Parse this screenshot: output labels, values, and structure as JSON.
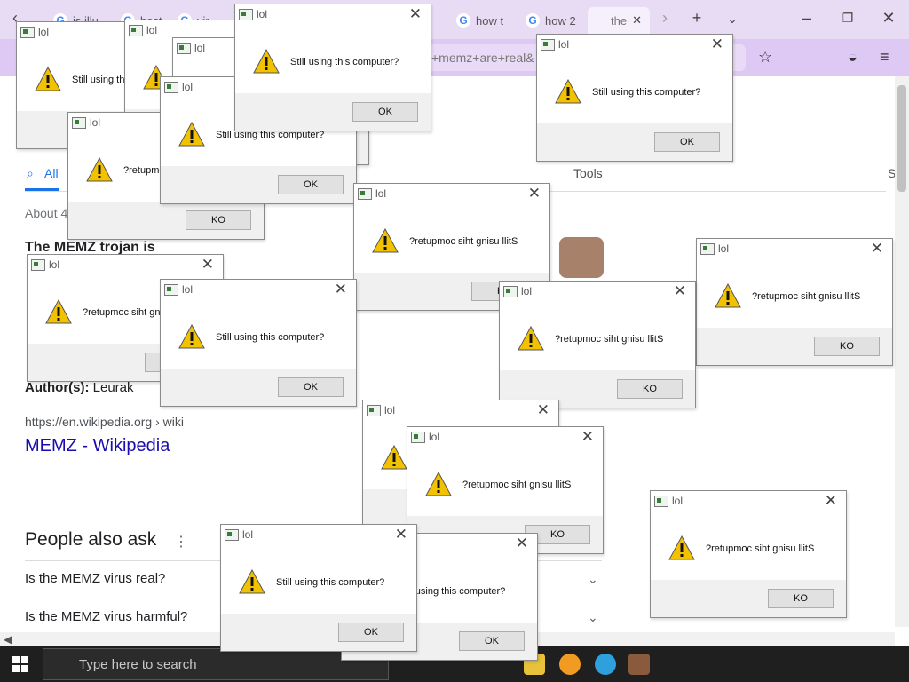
{
  "browser": {
    "tabs": [
      {
        "label": "is illu"
      },
      {
        "label": "best"
      },
      {
        "label": "vir"
      },
      {
        "label": "how t"
      },
      {
        "label": "how 2"
      },
      {
        "label": "the"
      }
    ],
    "url_fragment": "+memz+are+real&"
  },
  "page": {
    "all_tab": "All",
    "tools": "Tools",
    "about_prefix": "About 4",
    "snippet_bold": "The MEMZ trojan is",
    "author_label": "Author(s):",
    "author_value": "Leurak",
    "source": "https://en.wikipedia.org › wiki",
    "wiki_link": "MEMZ - Wikipedia",
    "people_also_ask": "People also ask",
    "questions": [
      "Is the MEMZ virus real?",
      "Is the MEMZ virus harmful?"
    ]
  },
  "taskbar": {
    "search_placeholder": "Type here to search"
  },
  "dialogs": [
    {
      "title": "lol",
      "message": "Still using this computer?",
      "button": "OK"
    },
    {
      "title": "lol",
      "message": "Still using this computer?",
      "button": "OK"
    },
    {
      "title": "lol",
      "message": "?retupmoc siht gnisu llitS",
      "button": "KO"
    },
    {
      "title": "lol",
      "message": "Still using this computer?",
      "button": "OK"
    },
    {
      "title": "lol",
      "message": "?retupmoc siht gnisu llitS",
      "button": "KO"
    },
    {
      "title": "lol",
      "message": "Still using this computer?",
      "button": "OK"
    },
    {
      "title": "lol",
      "message": "Still using this computer?",
      "button": "OK"
    },
    {
      "title": "lol",
      "message": "?retupmoc siht gnisu llitS",
      "button": "KO"
    },
    {
      "title": "lol",
      "message": "?retupmoc siht gnisu llitS",
      "button": "KO"
    },
    {
      "title": "lol",
      "message": "?retupmoc siht gnisu llitS",
      "button": "KO"
    },
    {
      "title": "lol",
      "message": "Still using this computer?",
      "button": "OK"
    },
    {
      "title": "lol",
      "message": "?retupmoc siht gnisu llitS",
      "button": "KO"
    },
    {
      "title": "lol",
      "message": "?retupmoc siht gnisu llitS",
      "button": "KO"
    },
    {
      "title": "lol",
      "message": "?retupmoc siht gnisu llitS",
      "button": "KO"
    },
    {
      "title": "lol",
      "message": "Still using this computer?",
      "button": "OK"
    },
    {
      "title": "lol",
      "message": "?retupmoc siht gnisu llitS",
      "button": "KO"
    },
    {
      "title": "lol",
      "message": "Still using this computer?",
      "button": "OK"
    }
  ]
}
